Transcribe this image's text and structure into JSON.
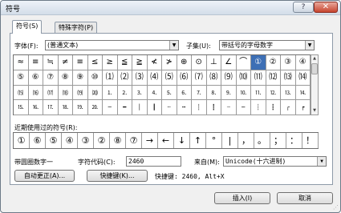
{
  "window": {
    "title": "符号",
    "help": "?",
    "close": "✕"
  },
  "tabs": [
    {
      "label": "符号(S)"
    },
    {
      "label": "特殊字符(P)"
    }
  ],
  "font": {
    "label": "字体(F):",
    "value": "(普通文本)"
  },
  "subset": {
    "label": "子集(U):",
    "value": "带括号的字母数字"
  },
  "grid_rows": [
    [
      "≈",
      "≡",
      "≒",
      "≠",
      "≡",
      "≤",
      "≥",
      "≦",
      "≧",
      "≮",
      "≯",
      "⊕",
      "⊙",
      "⊥",
      "∠",
      "⌒",
      "①",
      "②",
      "③",
      "④"
    ],
    [
      "⑤",
      "⑥",
      "⑦",
      "⑧",
      "⑨",
      "⑩",
      "⑴",
      "⑵",
      "⑶",
      "⑷",
      "⑸",
      "⑹",
      "⑺",
      "⑻",
      "⑼",
      "⑽",
      "⑾",
      "⑿",
      "⒀",
      "⒁"
    ],
    [
      "⒂",
      "⒃",
      "⒄",
      "⒅",
      "⒆",
      "⒇",
      "⒈",
      "⒉",
      "⒊",
      "⒋",
      "⒌",
      "⒍",
      "⒎",
      "⒏",
      "⒐",
      "⒑",
      "⒒",
      "⒓",
      "⒔",
      "⒕"
    ],
    [
      "⒖",
      "⒗",
      "⒘",
      "⒙",
      "⒚",
      "⒛",
      "─",
      "━",
      "│",
      "┃",
      "┄",
      "┅",
      "┆",
      "┇",
      "┈",
      "┉",
      "┊",
      "┋",
      "┌",
      "┍"
    ]
  ],
  "selected_symbol": "①",
  "recent": {
    "label": "近期使用过的符号(R):",
    "symbols": [
      "①",
      "⑥",
      "⑤",
      "④",
      "③",
      "②",
      "⑧",
      "⑦",
      "→",
      "←",
      "↓",
      "↑",
      "°",
      "|",
      "，",
      "。",
      "；",
      "：",
      "！"
    ]
  },
  "symbol_name": "带圆圈数字一",
  "char_code": {
    "label": "字符代码(C):",
    "value": "2460"
  },
  "from": {
    "label": "来自(M):",
    "value": "Unicode(十六进制)"
  },
  "buttons": {
    "autocorrect": "自动更正(A)...",
    "shortcut_key": "快捷键(K)...",
    "insert": "插入(I)",
    "cancel": "取消"
  },
  "shortcut_text": "快捷键: 2460, Alt+X"
}
